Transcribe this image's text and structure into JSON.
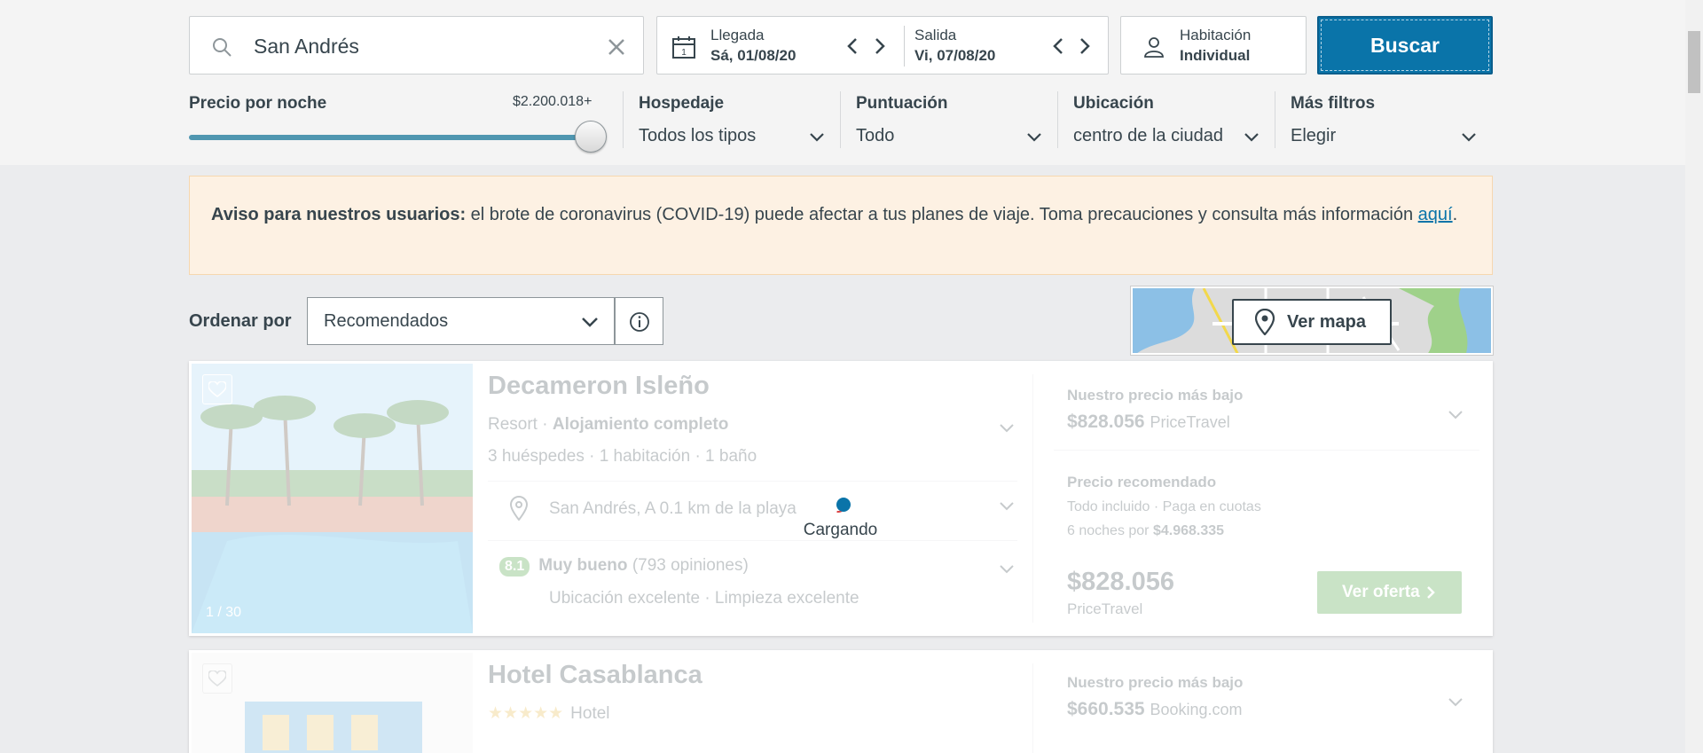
{
  "search": {
    "destination": "San Andrés"
  },
  "dates": {
    "checkin_label": "Llegada",
    "checkin_value": "Sá, 01/08/20",
    "checkout_label": "Salida",
    "checkout_value": "Vi, 07/08/20"
  },
  "room": {
    "label": "Habitación",
    "value": "Individual"
  },
  "search_button": "Buscar",
  "filters": {
    "price": {
      "label": "Precio por noche",
      "max": "$2.200.018+",
      "level_fraction": 1.0
    },
    "lodging": {
      "label": "Hospedaje",
      "value": "Todos los tipos"
    },
    "rating": {
      "label": "Puntuación",
      "value": "Todo"
    },
    "location": {
      "label": "Ubicación",
      "value": "centro de la ciudad"
    },
    "more": {
      "label": "Más filtros",
      "value": "Elegir"
    }
  },
  "notice": {
    "bold": "Aviso para nuestros usuarios:",
    "text": " el brote de coronavirus (COVID-19) puede afectar a tus planes de viaje. Toma precauciones y consulta más información ",
    "link": "aquí",
    "end": "."
  },
  "sort": {
    "label": "Ordenar por",
    "value": "Recomendados"
  },
  "map_button": "Ver mapa",
  "loading": "Cargando",
  "results": [
    {
      "name": "Decameron Isleño",
      "type": "Resort",
      "type_extra": "Alojamiento completo",
      "details": "3 huéspedes · 1 habitación · 1 baño",
      "location": "San Andrés, A 0.1 km de la playa",
      "score": "8.1",
      "score_label": "Muy bueno",
      "reviews": "(793 opiniones)",
      "highlights": "Ubicación excelente · Limpieza excelente",
      "photo_count": "1 / 30",
      "lowest_label": "Nuestro precio más bajo",
      "lowest_price": "$828.056",
      "lowest_provider": "PriceTravel",
      "recommended_label": "Precio recomendado",
      "recommended_desc": "Todo incluido · Paga en cuotas",
      "nights_text": "6 noches por ",
      "nights_total": "$4.968.335",
      "main_price": "$828.056",
      "main_provider": "PriceTravel",
      "offer_button": "Ver oferta"
    },
    {
      "name": "Hotel Casablanca",
      "type": "Hotel",
      "stars": "★★★★★",
      "lowest_label": "Nuestro precio más bajo",
      "lowest_price": "$660.535",
      "lowest_provider": "Booking.com"
    }
  ]
}
